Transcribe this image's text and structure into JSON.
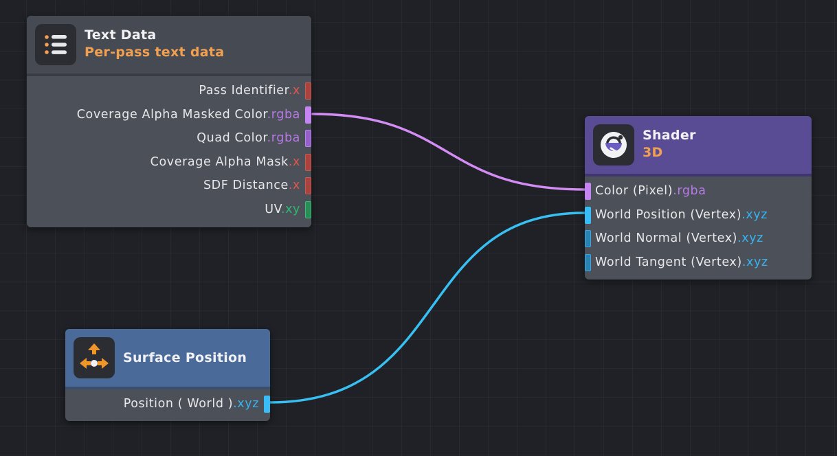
{
  "colors": {
    "background": "#1f2126",
    "node_body": "#4c5058",
    "shader_header": "#5a4c94",
    "surface_header": "#4a6a9a",
    "wire_rgba": "#d48cf5",
    "wire_xyz": "#38c0f2",
    "swizzle_x": "#e2574c",
    "swizzle_rgba": "#b77ae8",
    "swizzle_xy": "#2fb872",
    "swizzle_xyz": "#38b3f0",
    "subtitle": "#f0a050"
  },
  "nodes": {
    "text_data": {
      "icon": "list-icon",
      "title": "Text Data",
      "subtitle": "Per-pass text data",
      "outputs": [
        {
          "label": "Pass Identifier",
          "swizzle": ".x"
        },
        {
          "label": "Coverage Alpha Masked Color",
          "swizzle": ".rgba"
        },
        {
          "label": "Quad Color",
          "swizzle": ".rgba"
        },
        {
          "label": "Coverage Alpha Mask",
          "swizzle": ".x"
        },
        {
          "label": "SDF Distance",
          "swizzle": ".x"
        },
        {
          "label": "UV",
          "swizzle": ".xy"
        }
      ]
    },
    "shader": {
      "icon": "shader-icon",
      "title": "Shader",
      "subtitle": "3D",
      "inputs": [
        {
          "label": "Color (Pixel)",
          "swizzle": ".rgba"
        },
        {
          "label": "World Position (Vertex)",
          "swizzle": ".xyz"
        },
        {
          "label": "World Normal (Vertex)",
          "swizzle": ".xyz"
        },
        {
          "label": "World Tangent (Vertex)",
          "swizzle": ".xyz"
        }
      ]
    },
    "surface_position": {
      "icon": "move-arrows-icon",
      "title": "Surface Position",
      "outputs": [
        {
          "label": "Position ( World )",
          "swizzle": ".xyz"
        }
      ]
    }
  },
  "connections": [
    {
      "from": "Text Data / Coverage Alpha Masked Color",
      "to": "Shader / Color (Pixel)"
    },
    {
      "from": "Surface Position / Position ( World )",
      "to": "Shader / World Position (Vertex)"
    }
  ]
}
